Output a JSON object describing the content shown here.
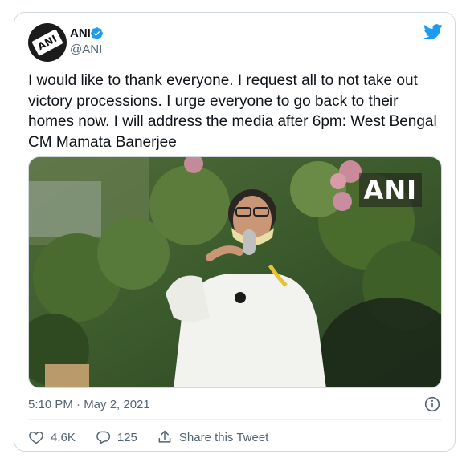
{
  "author": {
    "name": "ANI",
    "handle": "@ANI",
    "avatar_text": "ANI"
  },
  "tweet": {
    "text": "I would like to thank everyone. I request all to not take out victory processions. I urge everyone to go back to their homes now. I will address the media after 6pm: West Bengal CM Mamata Banerjee",
    "media_watermark": "ANI",
    "timestamp": "5:10 PM · May 2, 2021"
  },
  "actions": {
    "likes": "4.6K",
    "replies": "125",
    "share_label": "Share this Tweet"
  },
  "colors": {
    "twitter_blue": "#1d9bf0",
    "secondary_text": "#536471",
    "border": "#cfd9de"
  },
  "icons": [
    "verified-badge-icon",
    "twitter-bird-icon",
    "info-icon",
    "heart-icon",
    "reply-bubble-icon",
    "share-icon"
  ]
}
